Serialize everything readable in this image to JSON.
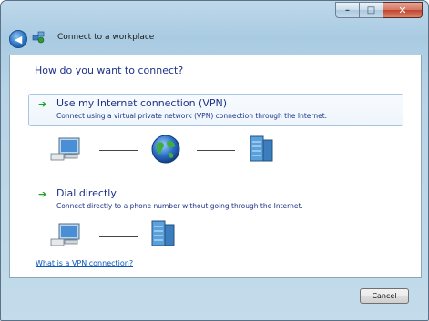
{
  "window": {
    "title": "Connect to a workplace",
    "caption_buttons": {
      "minimize": "–",
      "maximize": "□",
      "close": "✕"
    }
  },
  "nav": {
    "back_glyph": "◀"
  },
  "main": {
    "heading": "How do you want to connect?",
    "options": [
      {
        "title": "Use my Internet connection (VPN)",
        "description": "Connect using a virtual private network (VPN) connection through the Internet.",
        "icons": [
          "computer-icon",
          "globe-icon",
          "server-icon"
        ]
      },
      {
        "title": "Dial directly",
        "description": "Connect directly to a phone number without going through the Internet.",
        "icons": [
          "computer-icon",
          "server-icon"
        ]
      }
    ],
    "help_link": "What is a VPN connection?"
  },
  "footer": {
    "cancel_label": "Cancel"
  },
  "colors": {
    "heading": "#1e3287",
    "link": "#0b58b8",
    "arrow": "#1aa52a"
  }
}
